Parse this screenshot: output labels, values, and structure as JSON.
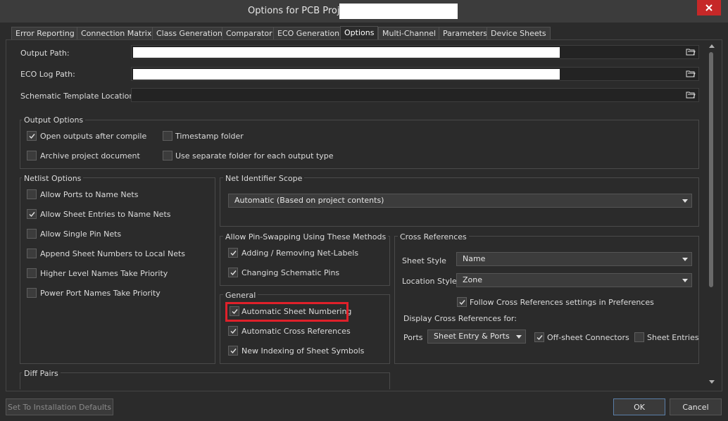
{
  "window": {
    "title": "Options for PCB Project",
    "close_icon": "close-icon"
  },
  "tabs": [
    {
      "label": "Error Reporting"
    },
    {
      "label": "Connection Matrix"
    },
    {
      "label": "Class Generation"
    },
    {
      "label": "Comparator"
    },
    {
      "label": "ECO Generation"
    },
    {
      "label": "Options",
      "active": true
    },
    {
      "label": "Multi-Channel"
    },
    {
      "label": "Parameters"
    },
    {
      "label": "Device Sheets"
    }
  ],
  "paths": {
    "output_path_label": "Output Path:",
    "eco_log_label": "ECO Log Path:",
    "schematic_template_label": "Schematic Template Location:"
  },
  "output_options": {
    "title": "Output Options",
    "open_outputs": {
      "label": "Open outputs after compile",
      "checked": true
    },
    "timestamp_folder": {
      "label": "Timestamp folder",
      "checked": false
    },
    "archive_project": {
      "label": "Archive project document",
      "checked": false
    },
    "separate_folder": {
      "label": "Use separate folder for each output type",
      "checked": false
    }
  },
  "netlist_options": {
    "title": "Netlist Options",
    "items": [
      {
        "label": "Allow Ports to Name Nets",
        "checked": false
      },
      {
        "label": "Allow Sheet Entries to Name Nets",
        "checked": true
      },
      {
        "label": "Allow Single Pin Nets",
        "checked": false
      },
      {
        "label": "Append Sheet Numbers to Local Nets",
        "checked": false
      },
      {
        "label": "Higher Level Names Take Priority",
        "checked": false
      },
      {
        "label": "Power Port Names Take Priority",
        "checked": false
      }
    ]
  },
  "net_identifier_scope": {
    "title": "Net Identifier Scope",
    "value": "Automatic (Based on project contents)"
  },
  "pin_swapping": {
    "title": "Allow Pin-Swapping Using These Methods",
    "items": [
      {
        "label": "Adding / Removing Net-Labels",
        "checked": true
      },
      {
        "label": "Changing Schematic Pins",
        "checked": true
      }
    ]
  },
  "general": {
    "title": "General",
    "items": [
      {
        "label": "Automatic Sheet Numbering",
        "checked": true
      },
      {
        "label": "Automatic Cross References",
        "checked": true
      },
      {
        "label": "New Indexing of Sheet Symbols",
        "checked": true
      }
    ]
  },
  "cross_references": {
    "title": "Cross References",
    "sheet_style_label": "Sheet Style",
    "sheet_style_value": "Name",
    "location_style_label": "Location Style",
    "location_style_value": "Zone",
    "follow_prefs": {
      "label": "Follow Cross References settings in Preferences",
      "checked": true
    },
    "display_for_label": "Display Cross References for:",
    "ports_label": "Ports",
    "ports_value": "Sheet Entry & Ports",
    "offsheet": {
      "label": "Off-sheet Connectors",
      "checked": true
    },
    "sheet_entries": {
      "label": "Sheet Entries",
      "checked": false
    }
  },
  "diff_pairs": {
    "title": "Diff Pairs"
  },
  "buttons": {
    "defaults": "Set To Installation Defaults",
    "ok": "OK",
    "cancel": "Cancel"
  },
  "colors": {
    "highlight": "#e0202a",
    "close": "#c62828"
  }
}
